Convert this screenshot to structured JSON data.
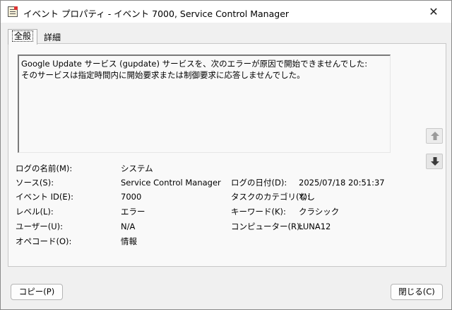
{
  "window": {
    "title": "イベント プロパティ - イベント 7000, Service Control Manager",
    "close_glyph": "✕"
  },
  "tabs": [
    {
      "label": "全般"
    },
    {
      "label": "詳細"
    }
  ],
  "description": "Google Update サービス (gupdate) サービスを、次のエラーが原因で開始できませんでした:\nそのサービスは指定時間内に開始要求または制御要求に応答しませんでした。",
  "fields": {
    "log_name": {
      "label": "ログの名前(M):",
      "value": "システム"
    },
    "source": {
      "label": "ソース(S):",
      "value": "Service Control Manager"
    },
    "logged": {
      "label": "ログの日付(D):",
      "value": "2025/07/18 20:51:37"
    },
    "event_id": {
      "label": "イベント ID(E):",
      "value": "7000"
    },
    "task_category": {
      "label": "タスクのカテゴリ(Y):",
      "value": "なし"
    },
    "level": {
      "label": "レベル(L):",
      "value": "エラー"
    },
    "keywords": {
      "label": "キーワード(K):",
      "value": "クラシック"
    },
    "user": {
      "label": "ユーザー(U):",
      "value": "N/A"
    },
    "computer": {
      "label": "コンピューター(R):",
      "value": "LUNA12"
    },
    "opcode": {
      "label": "オペコード(O):",
      "value": "情報"
    }
  },
  "buttons": {
    "copy": "コピー(P)",
    "close": "閉じる(C)"
  },
  "icons": {
    "up": "arrow-up-icon",
    "down": "arrow-down-icon"
  }
}
